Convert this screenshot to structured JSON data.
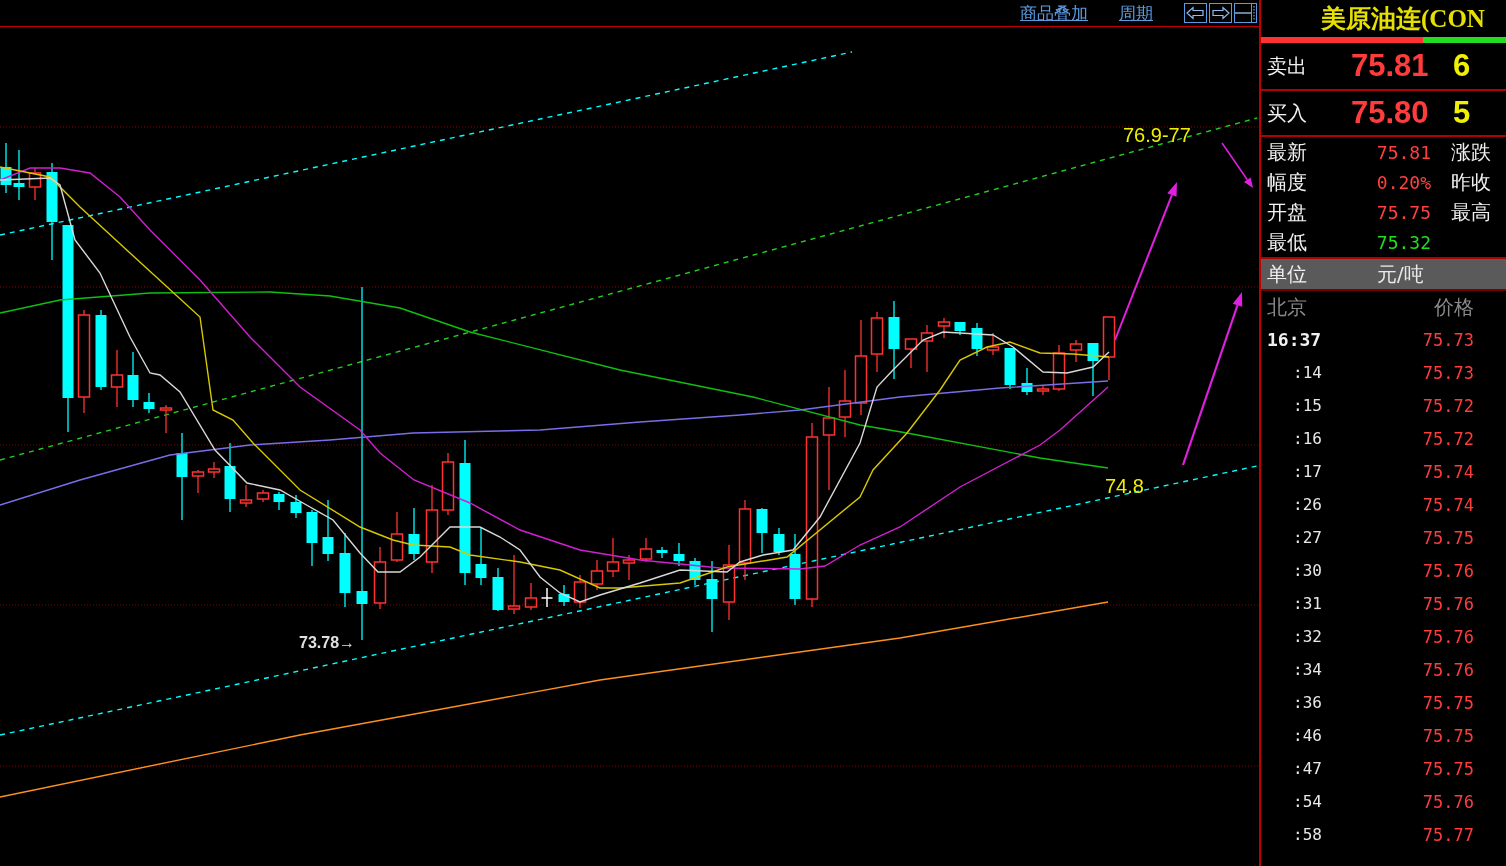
{
  "toolbar": {
    "links": [
      "商品叠加",
      "周期"
    ]
  },
  "chart": {
    "annotations": [
      {
        "text": "76.9-77"
      },
      {
        "text": "74.8"
      }
    ],
    "low_label": "73.78→"
  },
  "quote": {
    "title": "美原油连(CON",
    "ratio_bar": {
      "level": 0.66
    },
    "order_book": [
      {
        "label": "卖出",
        "price": "75.81",
        "volume": "6"
      },
      {
        "label": "买入",
        "price": "75.80",
        "volume": "5"
      }
    ],
    "stats": [
      {
        "label": "最新",
        "value": "75.81",
        "color": "#ff4040",
        "second_label": "涨跌"
      },
      {
        "label": "幅度",
        "value": "0.20%",
        "color": "#ff4040",
        "second_label": "昨收"
      },
      {
        "label": "开盘",
        "value": "75.75",
        "color": "#ff4040",
        "second_label": "最高"
      },
      {
        "label": "最低",
        "value": "75.32",
        "color": "#22dd22"
      }
    ],
    "unit": {
      "label": "单位",
      "value": "元/吨"
    },
    "ticks_header": {
      "time": "北京",
      "price": "价格"
    },
    "ticks": [
      {
        "kind": "minute",
        "time": "16:37",
        "price": "75.73"
      },
      {
        "kind": "second",
        "time": ":14",
        "price": "75.73"
      },
      {
        "kind": "second",
        "time": ":15",
        "price": "75.72"
      },
      {
        "kind": "second",
        "time": ":16",
        "price": "75.72"
      },
      {
        "kind": "second",
        "time": ":17",
        "price": "75.74"
      },
      {
        "kind": "second",
        "time": ":26",
        "price": "75.74"
      },
      {
        "kind": "second",
        "time": ":27",
        "price": "75.75"
      },
      {
        "kind": "second",
        "time": ":30",
        "price": "75.76"
      },
      {
        "kind": "second",
        "time": ":31",
        "price": "75.76"
      },
      {
        "kind": "second",
        "time": ":32",
        "price": "75.76"
      },
      {
        "kind": "second",
        "time": ":34",
        "price": "75.76"
      },
      {
        "kind": "second",
        "time": ":36",
        "price": "75.75"
      },
      {
        "kind": "second",
        "time": ":46",
        "price": "75.75"
      },
      {
        "kind": "second",
        "time": ":47",
        "price": "75.75"
      },
      {
        "kind": "second",
        "time": ":54",
        "price": "75.76"
      },
      {
        "kind": "second",
        "time": ":58",
        "price": "75.77"
      }
    ]
  }
}
